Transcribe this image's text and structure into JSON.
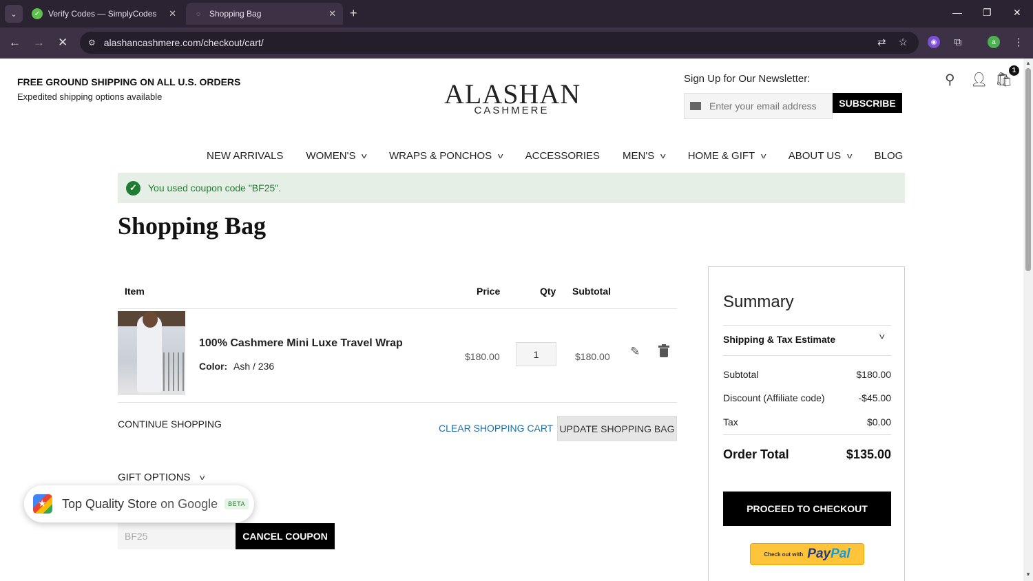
{
  "browser": {
    "tabs": [
      {
        "title": "Verify Codes — SimplyCodes",
        "active": false
      },
      {
        "title": "Shopping Bag",
        "active": true
      }
    ],
    "url": "alashancashmere.com/checkout/cart/",
    "profile_initial": "a"
  },
  "header": {
    "promo_title": "FREE GROUND SHIPPING ON ALL U.S. ORDERS",
    "promo_sub": "Expedited shipping options available",
    "logo_main": "ALASHAN",
    "logo_sub": "CASHMERE",
    "newsletter_label": "Sign Up for Our Newsletter:",
    "newsletter_placeholder": "Enter your email address",
    "subscribe_label": "SUBSCRIBE",
    "cart_count": "1"
  },
  "nav": [
    {
      "label": "NEW ARRIVALS",
      "dropdown": false
    },
    {
      "label": "WOMEN'S",
      "dropdown": true
    },
    {
      "label": "WRAPS & PONCHOS",
      "dropdown": true
    },
    {
      "label": "ACCESSORIES",
      "dropdown": false
    },
    {
      "label": "MEN'S",
      "dropdown": true
    },
    {
      "label": "HOME & GIFT",
      "dropdown": true
    },
    {
      "label": "ABOUT US",
      "dropdown": true
    },
    {
      "label": "BLOG",
      "dropdown": false
    }
  ],
  "alert": {
    "text": "You used coupon code \"BF25\".",
    "color": "#1e7d32"
  },
  "page_title": "Shopping Bag",
  "cart": {
    "columns": {
      "item": "Item",
      "price": "Price",
      "qty": "Qty",
      "subtotal": "Subtotal"
    },
    "items": [
      {
        "name": "100% Cashmere Mini Luxe Travel Wrap",
        "color_label": "Color:",
        "color_value": "Ash / 236",
        "price": "$180.00",
        "qty": "1",
        "subtotal": "$180.00"
      }
    ],
    "continue_label": "CONTINUE SHOPPING",
    "clear_label": "CLEAR SHOPPING CART",
    "update_label": "UPDATE SHOPPING BAG",
    "gift_label": "GIFT OPTIONS",
    "coupon_value": "BF25",
    "cancel_coupon_label": "CANCEL COUPON"
  },
  "google_badge": {
    "text": "Top Quality Store",
    "on": "on Google",
    "beta": "BETA"
  },
  "summary": {
    "title": "Summary",
    "shipping_label": "Shipping & Tax Estimate",
    "rows": [
      {
        "label": "Subtotal",
        "value": "$180.00"
      },
      {
        "label": "Discount (Affiliate code)",
        "value": "-$45.00"
      },
      {
        "label": "Tax",
        "value": "$0.00"
      }
    ],
    "total_label": "Order Total",
    "total_value": "$135.00",
    "checkout_label": "PROCEED TO CHECKOUT",
    "paypal_small": "Check out with",
    "paypal_pay": "Pay",
    "paypal_pal": "Pal"
  },
  "colors": {
    "link": "#1d6fa5",
    "accent_dark": "#000000",
    "paypal_yellow": "#ffc43a"
  }
}
